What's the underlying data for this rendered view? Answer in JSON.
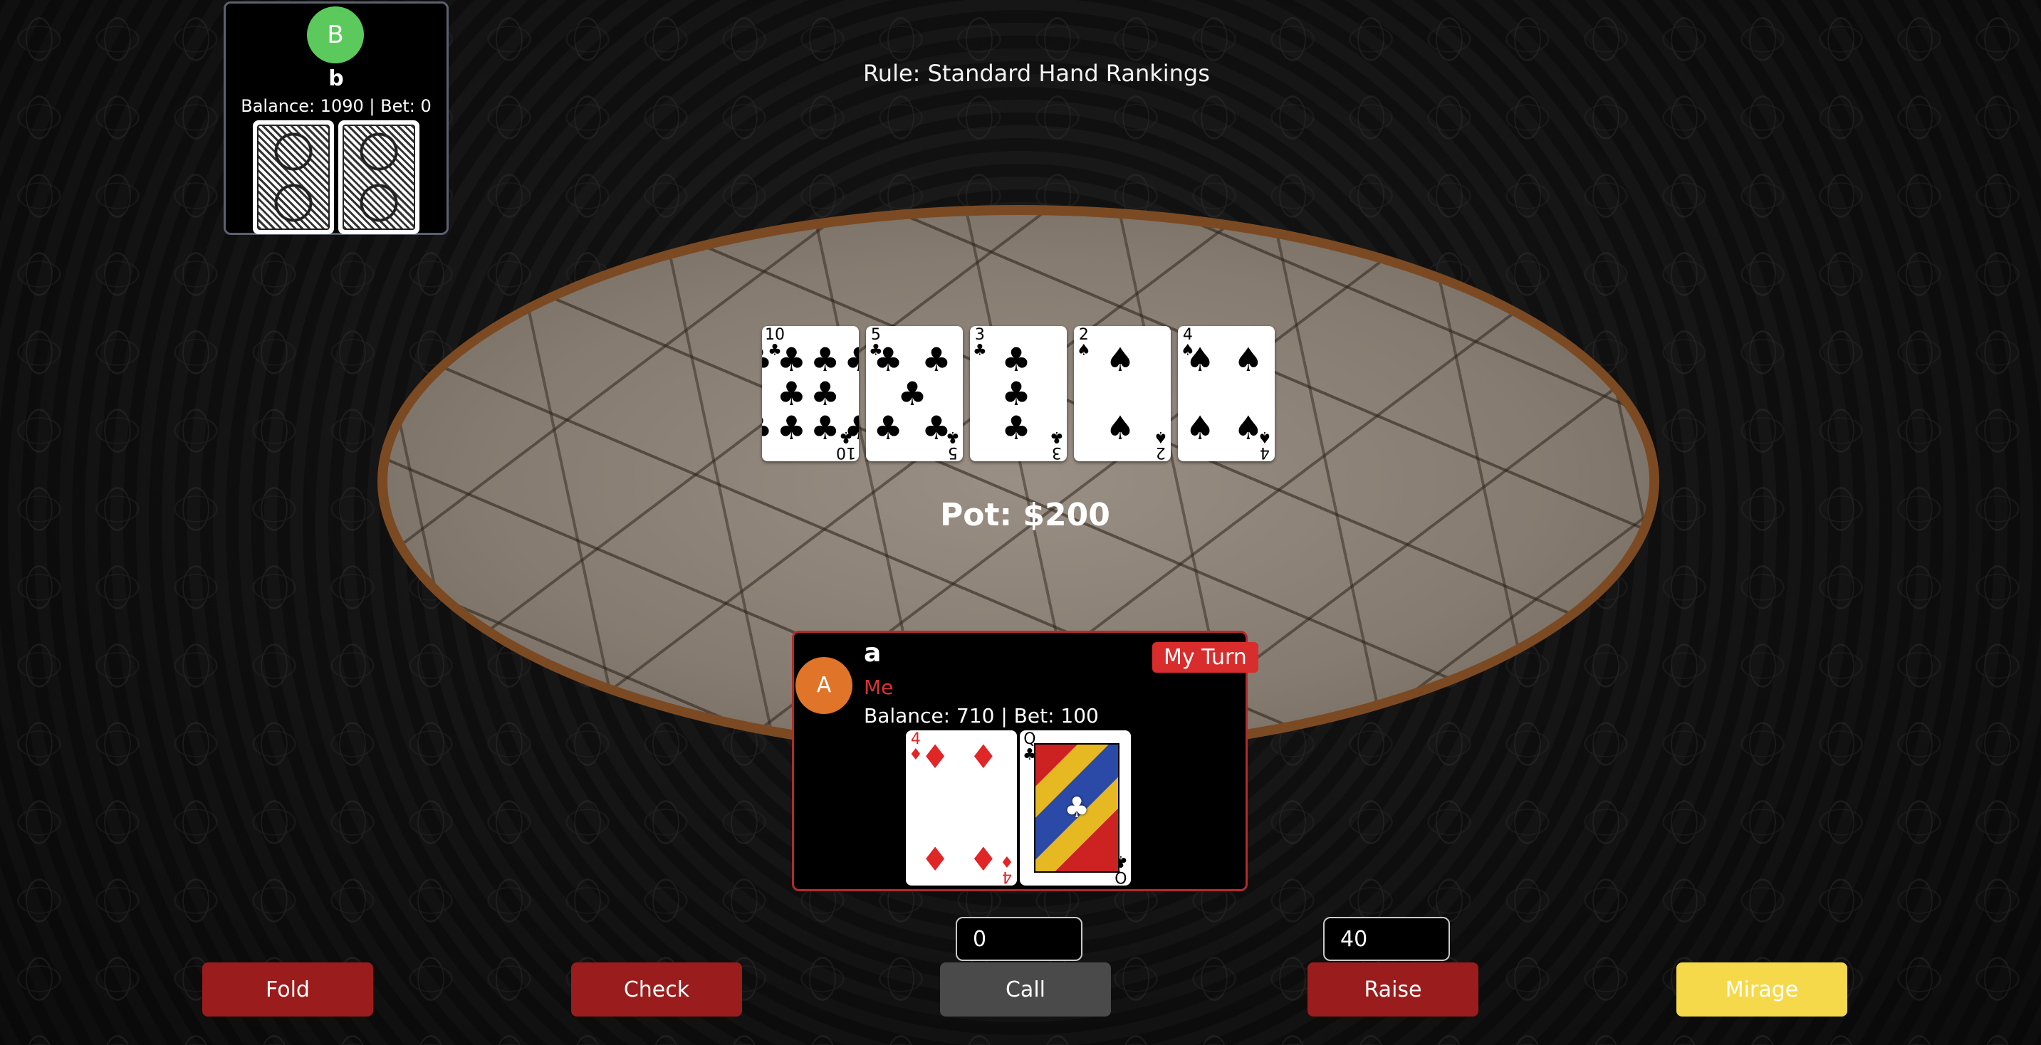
{
  "rule_text": "Rule: Standard Hand Rankings",
  "opponent": {
    "avatar": "B",
    "name": "b",
    "balance_text": "Balance: 1090 | Bet: 0",
    "avatar_color": "#5cc95c"
  },
  "community_cards": [
    {
      "rank": "10",
      "suit": "♣",
      "pips": "♣♣♣♣\n♣♣\n♣♣♣♣",
      "color": "black"
    },
    {
      "rank": "5",
      "suit": "♣",
      "pips": "♣ ♣\n♣\n♣ ♣",
      "color": "black"
    },
    {
      "rank": "3",
      "suit": "♣",
      "pips": "♣\n♣\n♣",
      "color": "black"
    },
    {
      "rank": "2",
      "suit": "♠",
      "pips": "♠\n\n♠",
      "color": "black"
    },
    {
      "rank": "4",
      "suit": "♠",
      "pips": "♠ ♠\n\n♠ ♠",
      "color": "black"
    }
  ],
  "pot_text": "Pot: $200",
  "player": {
    "avatar": "A",
    "name": "a",
    "tag": "Me",
    "balance_text": "Balance: 710 | Bet: 100",
    "turn_badge": "My Turn",
    "avatar_color": "#e07428"
  },
  "player_cards": [
    {
      "rank": "4",
      "suit": "♦",
      "pips": "♦ ♦\n\n\n♦ ♦",
      "color": "red"
    },
    {
      "rank": "Q",
      "suit": "♣",
      "pips": "",
      "color": "black",
      "face": true
    }
  ],
  "call_input_value": "0",
  "raise_input_value": "40",
  "buttons": {
    "fold": "Fold",
    "check": "Check",
    "call": "Call",
    "raise": "Raise",
    "mirage": "Mirage"
  },
  "colors": {
    "button_red": "#9b1c1c",
    "button_gray": "#4a4a4a",
    "button_yellow": "#f6d94a",
    "table_rim": "#7b4a23"
  }
}
